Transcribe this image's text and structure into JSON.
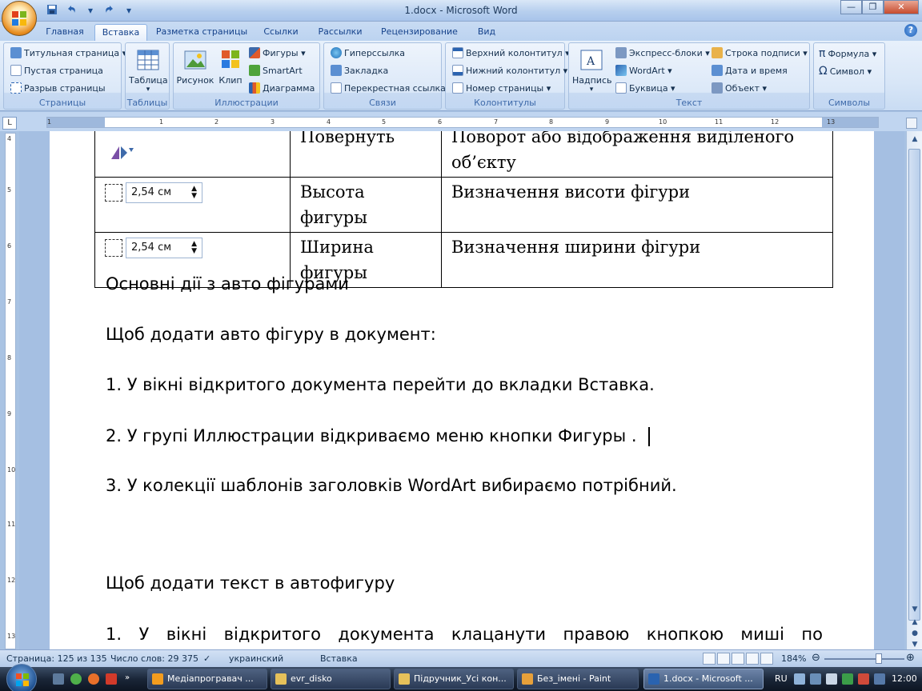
{
  "window": {
    "title": "1.docx - Microsoft Word",
    "controls": {
      "minimize": "—",
      "maximize": "❐",
      "close": "✕"
    }
  },
  "qat": {
    "save_icon": "save-icon",
    "undo_icon": "undo-icon",
    "redo_icon": "redo-icon",
    "more": "▾"
  },
  "tabs": [
    {
      "label": "Главная",
      "active": false
    },
    {
      "label": "Вставка",
      "active": true
    },
    {
      "label": "Разметка страницы",
      "active": false
    },
    {
      "label": "Ссылки",
      "active": false
    },
    {
      "label": "Рассылки",
      "active": false
    },
    {
      "label": "Рецензирование",
      "active": false
    },
    {
      "label": "Вид",
      "active": false
    }
  ],
  "ribbon": {
    "groups": {
      "pages": {
        "label": "Страницы",
        "items": [
          "Титульная страница ▾",
          "Пустая страница",
          "Разрыв страницы"
        ]
      },
      "tables": {
        "label": "Таблицы",
        "table": "Таблица"
      },
      "illustrations": {
        "label": "Иллюстрации",
        "picture": "Рисунок",
        "clip": "Клип",
        "shapes": "Фигуры ▾",
        "smartart": "SmartArt",
        "chart": "Диаграмма"
      },
      "links": {
        "label": "Связи",
        "items": [
          "Гиперссылка",
          "Закладка",
          "Перекрестная ссылка"
        ]
      },
      "headers": {
        "label": "Колонтитулы",
        "items": [
          "Верхний колонтитул ▾",
          "Нижний колонтитул ▾",
          "Номер страницы ▾"
        ]
      },
      "text": {
        "label": "Текст",
        "textbox": "Надпись",
        "items1": [
          "Экспресс-блоки ▾",
          "WordArt ▾",
          "Буквица ▾"
        ],
        "items2": [
          "Строка подписи ▾",
          "Дата и время",
          "Объект ▾"
        ]
      },
      "symbols": {
        "label": "Символы",
        "items": [
          "Формула ▾",
          "Символ ▾"
        ]
      }
    }
  },
  "ruler": {
    "corner": "L",
    "ticks": [
      "1",
      "1",
      "2",
      "3",
      "4",
      "5",
      "6",
      "7",
      "8",
      "9",
      "10",
      "11",
      "12",
      "13"
    ],
    "vticks": [
      "4",
      "5",
      "6",
      "7",
      "8",
      "9",
      "10",
      "11",
      "12",
      "13"
    ]
  },
  "document": {
    "table": [
      {
        "col2": "Повернуть",
        "col3": "Поворот або відображення виділеного об’єкту"
      },
      {
        "value": "2,54 см",
        "col2": "Высота фигуры",
        "col3": "Визначення висоти фігури"
      },
      {
        "value": "2,54 см",
        "col2": "Ширина фигуры",
        "col3": "Визначення ширини фігури"
      }
    ],
    "paragraphs": [
      "Основні дії з авто фігурами",
      "Щоб додати авто фігуру в документ:",
      "1. У вікні відкритого документа перейти до вкладки Вставка.",
      "2. У групі Иллюстрации відкриваємо меню кнопки Фигуры .",
      "3. У колекції шаблонів заголовків WordArt вибираємо потрібний.",
      "Щоб додати текст в автофигуру",
      "1.  У  вікні  відкритого  документа  клацанути  правою  кнопкою  миші  по"
    ]
  },
  "status": {
    "page": "Страница: 125 из 135",
    "words": "Число слов: 29 375",
    "language": "украинский",
    "mode": "Вставка",
    "zoom": "184%",
    "zoom_level": 0.68
  },
  "taskbar": {
    "tasks": [
      {
        "label": "Медіапрогравач ...",
        "active": false
      },
      {
        "label": "evr_disko",
        "active": false
      },
      {
        "label": "Підручник_Усі кон...",
        "active": false
      },
      {
        "label": "Без_імені - Paint",
        "active": false
      },
      {
        "label": "1.docx - Microsoft ...",
        "active": true
      }
    ],
    "lang": "RU",
    "time": "12:00"
  },
  "colors": {
    "accent": "#15428b",
    "ribbon": "#dbe8f8",
    "taskbar": "#1a2638"
  }
}
